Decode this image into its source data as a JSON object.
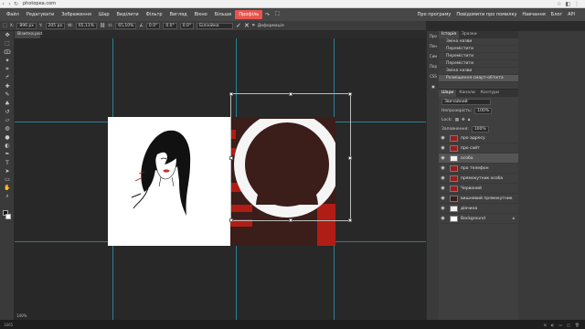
{
  "browser": {
    "url": "photopea.com",
    "nav_icons": [
      "back-icon",
      "forward-icon",
      "reload-icon"
    ],
    "right_icons": [
      "star-icon",
      "extension-icon",
      "menu-icon"
    ]
  },
  "menubar": {
    "items": [
      "Файл",
      "Редагувати",
      "Зображення",
      "Шар",
      "Виділити",
      "Фільтр",
      "Вигляд",
      "Вікно",
      "Більше"
    ],
    "profile": "Профіль",
    "right_items": [
      "Про програму",
      "Повідомити про помилку",
      "Навчання",
      "Блог",
      "API"
    ],
    "colors": {
      "profile_bg": "#e8554e",
      "menu_bg": "#474747"
    }
  },
  "options": {
    "x": "896 px",
    "y": "205 px",
    "w": "65,11%",
    "h": "65,10%",
    "angle": "0.0°",
    "skew_h": "0.0°",
    "skew_v": "0.0°",
    "interpolation": "Білінійна",
    "deform_label": "Деформація"
  },
  "document": {
    "tab_title": "Візитка.psd *",
    "zoom": "140%"
  },
  "history": {
    "tabs": [
      "Історія",
      "Зразки"
    ],
    "items": [
      "Зміна назви",
      "Перемістити",
      "Перемістити",
      "Перемістити",
      "Зміна назви",
      "Розміщення смарт-об'єкта"
    ]
  },
  "side_icons": [
    "Про",
    "Пен",
    "Сим",
    "Пор",
    "CSS"
  ],
  "layers": {
    "tabs": [
      "Шари",
      "Канали",
      "Контури"
    ],
    "blend_mode": "Звичайний",
    "opacity_label": "Непрозорість:",
    "opacity_value": "100%",
    "lock_label": "Lock:",
    "fill_label": "Заповнення:",
    "fill_value": "100%",
    "items": [
      {
        "name": "про адресу",
        "thumb": "#9a1c1c",
        "selected": false
      },
      {
        "name": "про сайт",
        "thumb": "#9a1c1c",
        "selected": false
      },
      {
        "name": "особа",
        "thumb": "#f2f2f2",
        "selected": true
      },
      {
        "name": "про телефон",
        "thumb": "#9a1c1c",
        "selected": false
      },
      {
        "name": "прямокутник особа",
        "thumb": "#9a1c1c",
        "selected": false
      },
      {
        "name": "Червоний",
        "thumb": "#9a1c1c",
        "selected": false
      },
      {
        "name": "вишневий прямокутник",
        "thumb": "#3b1d1a",
        "selected": false
      },
      {
        "name": "дівчина",
        "thumb": "#f2f2f2",
        "selected": false
      },
      {
        "name": "Background",
        "thumb": "#ffffff",
        "selected": false
      }
    ]
  },
  "status": {
    "left": "1665"
  },
  "colors": {
    "canvas": "#282828",
    "guide": "#2ea3c3",
    "card_red": "#b01d16",
    "card_dark": "#3b1d1a",
    "avatar": "#3b1d1a"
  }
}
